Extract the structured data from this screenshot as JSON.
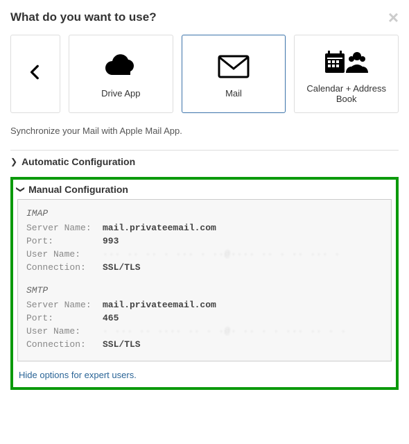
{
  "header": {
    "title": "What do you want to use?"
  },
  "cards": {
    "drive": "Drive App",
    "mail": "Mail",
    "calendar": "Calendar + Address Book"
  },
  "description": "Synchronize your Mail with Apple Mail App.",
  "sections": {
    "auto": "Automatic Configuration",
    "manual": "Manual Configuration"
  },
  "config": {
    "imap": {
      "title": "IMAP",
      "server_key": "Server Name:",
      "server_val": "mail.privateemail.com",
      "port_key": "Port:",
      "port_val": "993",
      "user_key": "User Name:",
      "user_val": "··· ·· ·· · ··· · ··@···· ·· · ·· ··· ·",
      "conn_key": "Connection:",
      "conn_val": "SSL/TLS"
    },
    "smtp": {
      "title": "SMTP",
      "server_key": "Server Name:",
      "server_val": "mail.privateemail.com",
      "port_key": "Port:",
      "port_val": "465",
      "user_key": "User Name:",
      "user_val": "· ··· ·· ···· ·· · ·@· ·· · · ··· ·· · ·",
      "conn_key": "Connection:",
      "conn_val": "SSL/TLS"
    }
  },
  "expert_link": "Hide options for expert users."
}
